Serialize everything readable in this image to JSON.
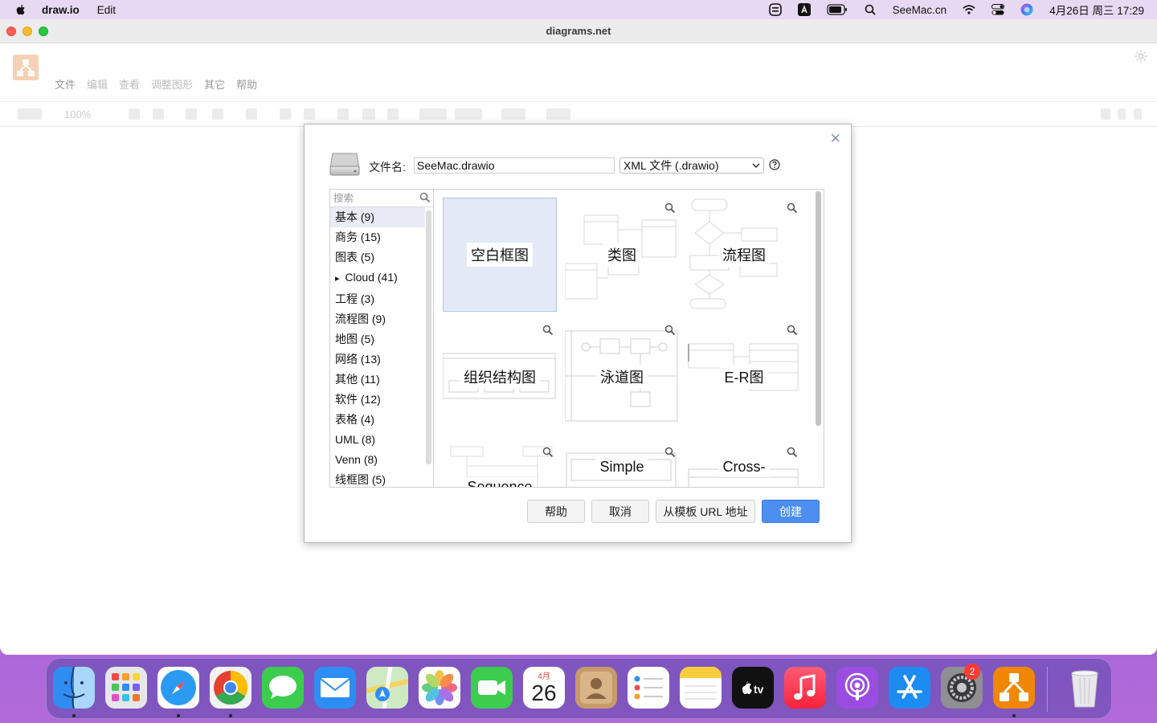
{
  "menubar": {
    "app_name": "draw.io",
    "menus": [
      "Edit"
    ],
    "site": "SeeMac.cn",
    "datetime": "4月26日 周三  17:29"
  },
  "window": {
    "title": "diagrams.net",
    "app_menus": [
      "文件",
      "编辑",
      "查看",
      "调整图形",
      "其它",
      "帮助"
    ],
    "zoom": "100%"
  },
  "dialog": {
    "filename_label": "文件名:",
    "filename_value": "SeeMac.drawio",
    "format_value": "XML 文件 (.drawio)",
    "search_placeholder": "搜索",
    "categories": [
      "基本 (9)",
      "商务 (15)",
      "图表 (5)",
      "Cloud (41)",
      "工程 (3)",
      "流程图 (9)",
      "地图 (5)",
      "网络 (13)",
      "其他 (11)",
      "软件 (12)",
      "表格 (4)",
      "UML (8)",
      "Venn (8)",
      "线框图 (5)"
    ],
    "cloud_expander": "▸",
    "templates": [
      "空白框图",
      "类图",
      "流程图",
      "组织结构图",
      "泳道图",
      "E-R图",
      "Sequence",
      "Simple",
      "Cross-"
    ],
    "buttons": {
      "help": "帮助",
      "cancel": "取消",
      "from_url": "从模板 URL 地址",
      "create": "创建"
    }
  },
  "dock": {
    "calendar_month": "4月",
    "calendar_day": "26",
    "settings_badge": "2"
  },
  "colors": {
    "primary_button": "#4d8ef1",
    "selected_template": "#e3e9f7",
    "drawio_orange": "#f08705"
  }
}
